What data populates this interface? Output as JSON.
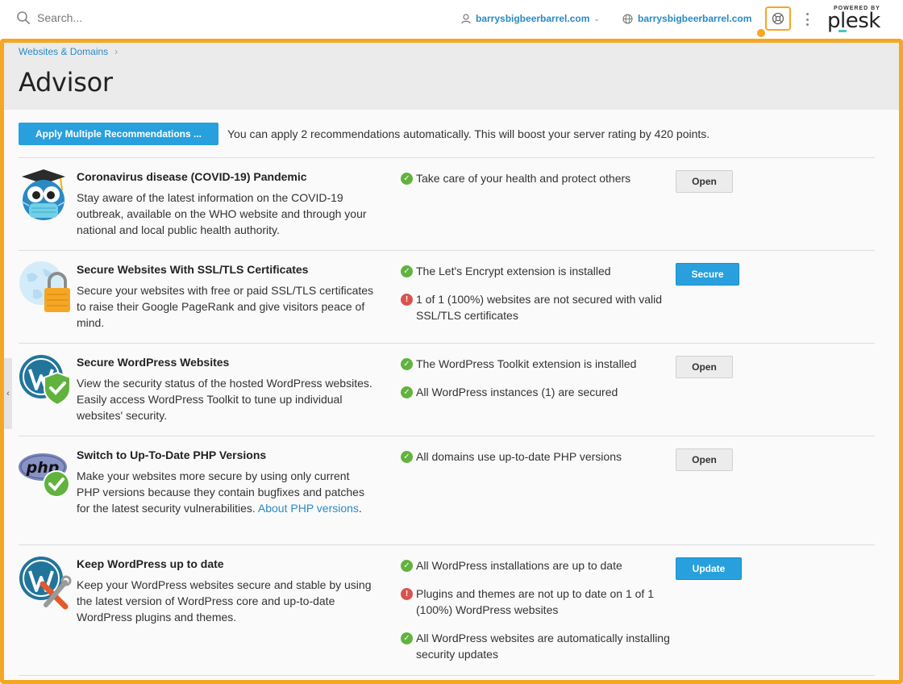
{
  "search": {
    "placeholder": "Search..."
  },
  "topbar": {
    "user_label": "barrysbigbeerbarrel.com",
    "site_label": "barrysbigbeerbarrel.com",
    "logo_powered": "POWERED BY",
    "logo_name": "plesk"
  },
  "breadcrumb": {
    "item": "Websites & Domains"
  },
  "page": {
    "title": "Advisor"
  },
  "apply": {
    "button_label": "Apply Multiple Recommendations ...",
    "text": "You can apply 2 recommendations automatically. This will boost your server rating by 420 points."
  },
  "recommendations": [
    {
      "title": "Coronavirus disease (COVID-19) Pandemic",
      "desc": "Stay aware of the latest information on the COVID-19 outbreak, available on the WHO website and through your national and local public health authority.",
      "statuses": [
        {
          "kind": "ok",
          "text": "Take care of your health and protect others"
        }
      ],
      "button": "Open"
    },
    {
      "title": "Secure Websites With SSL/TLS Certificates",
      "desc": "Secure your websites with free or paid SSL/TLS certificates to raise their Google PageRank and give visitors peace of mind.",
      "statuses": [
        {
          "kind": "ok",
          "text": "The Let's Encrypt extension is installed"
        },
        {
          "kind": "err",
          "text": "1 of 1 (100%) websites are not secured with valid SSL/TLS certificates"
        }
      ],
      "button": "Secure"
    },
    {
      "title": "Secure WordPress Websites",
      "desc": "View the security status of the hosted WordPress websites. Easily access WordPress Toolkit to tune up individual websites' security.",
      "statuses": [
        {
          "kind": "ok",
          "text": "The WordPress Toolkit extension is installed"
        },
        {
          "kind": "ok",
          "text": "All WordPress instances (1) are secured"
        }
      ],
      "button": "Open"
    },
    {
      "title": "Switch to Up-To-Date PHP Versions",
      "desc": "Make your websites more secure by using only current PHP versions because they contain bugfixes and patches for the latest security vulnerabilities.",
      "link": "About PHP versions",
      "link_suffix": ".",
      "statuses": [
        {
          "kind": "ok",
          "text": "All domains use up-to-date PHP versions"
        }
      ],
      "button": "Open"
    },
    {
      "title": "Keep WordPress up to date",
      "desc": "Keep your WordPress websites secure and stable by using the latest version of WordPress core and up-to-date WordPress plugins and themes.",
      "statuses": [
        {
          "kind": "ok",
          "text": "All WordPress installations are up to date"
        },
        {
          "kind": "err",
          "text": "Plugins and themes are not up to date on 1 of 1 (100%) WordPress websites"
        },
        {
          "kind": "ok",
          "text": "All WordPress websites are automatically installing security updates"
        }
      ],
      "button": "Update"
    }
  ],
  "icons": {
    "search": "search-icon",
    "user": "user-icon",
    "globe": "globe-icon",
    "help": "help-lifebuoy-icon",
    "more": "kebab-menu-icon"
  },
  "colors": {
    "accent": "#28a0dd",
    "highlight": "#f5a623",
    "ok": "#61b33e",
    "error": "#d9534f",
    "link": "#2a8ac6"
  }
}
